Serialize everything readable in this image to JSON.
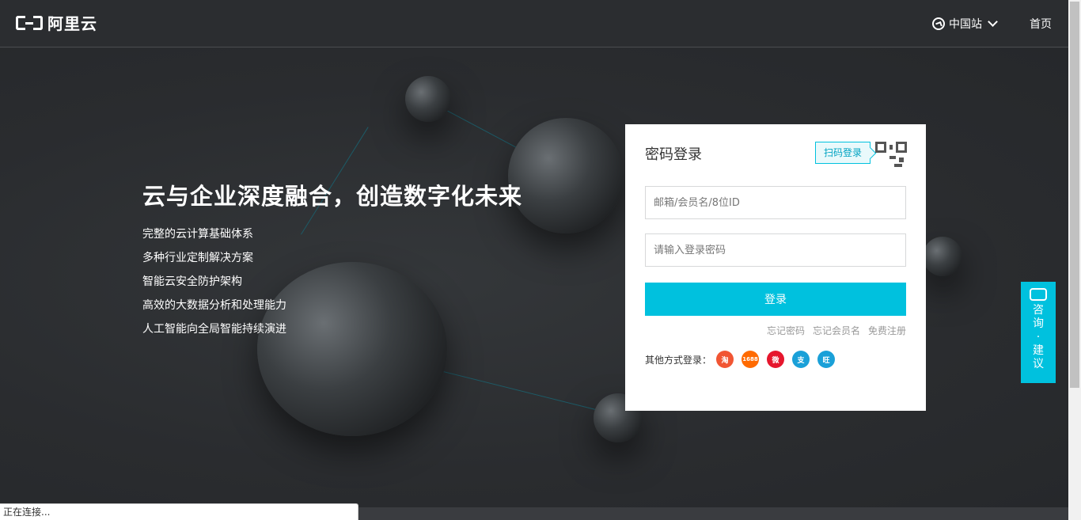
{
  "header": {
    "logo_text": "阿里云",
    "site_switch_label": "中国站",
    "home_label": "首页"
  },
  "hero": {
    "title": "云与企业深度融合，创造数字化未来",
    "features": [
      "完整的云计算基础体系",
      "多种行业定制解决方案",
      "智能云安全防护架构",
      "高效的大数据分析和处理能力",
      "人工智能向全局智能持续演进"
    ]
  },
  "login": {
    "title": "密码登录",
    "qr_tip": "扫码登录",
    "username_placeholder": "邮箱/会员名/8位ID",
    "password_placeholder": "请输入登录密码",
    "submit_label": "登录",
    "forgot_password": "忘记密码",
    "forgot_username": "忘记会员名",
    "register": "免费注册",
    "other_methods_label": "其他方式登录：",
    "other_methods": [
      {
        "name": "taobao-icon",
        "glyph": "淘",
        "color": "#f15533"
      },
      {
        "name": "1688-icon",
        "glyph": "1688",
        "color": "#ff6a00"
      },
      {
        "name": "weibo-icon",
        "glyph": "微",
        "color": "#e6162d"
      },
      {
        "name": "alipay-icon",
        "glyph": "支",
        "color": "#1aa0d8"
      },
      {
        "name": "aliwangwang-icon",
        "glyph": "旺",
        "color": "#1aa0d8"
      }
    ]
  },
  "consult": {
    "chars": [
      "咨",
      "询",
      "·",
      "建",
      "议"
    ]
  },
  "status_bar": {
    "text": "正在连接..."
  },
  "colors": {
    "accent": "#00c1de",
    "background": "#2a2c2f"
  }
}
